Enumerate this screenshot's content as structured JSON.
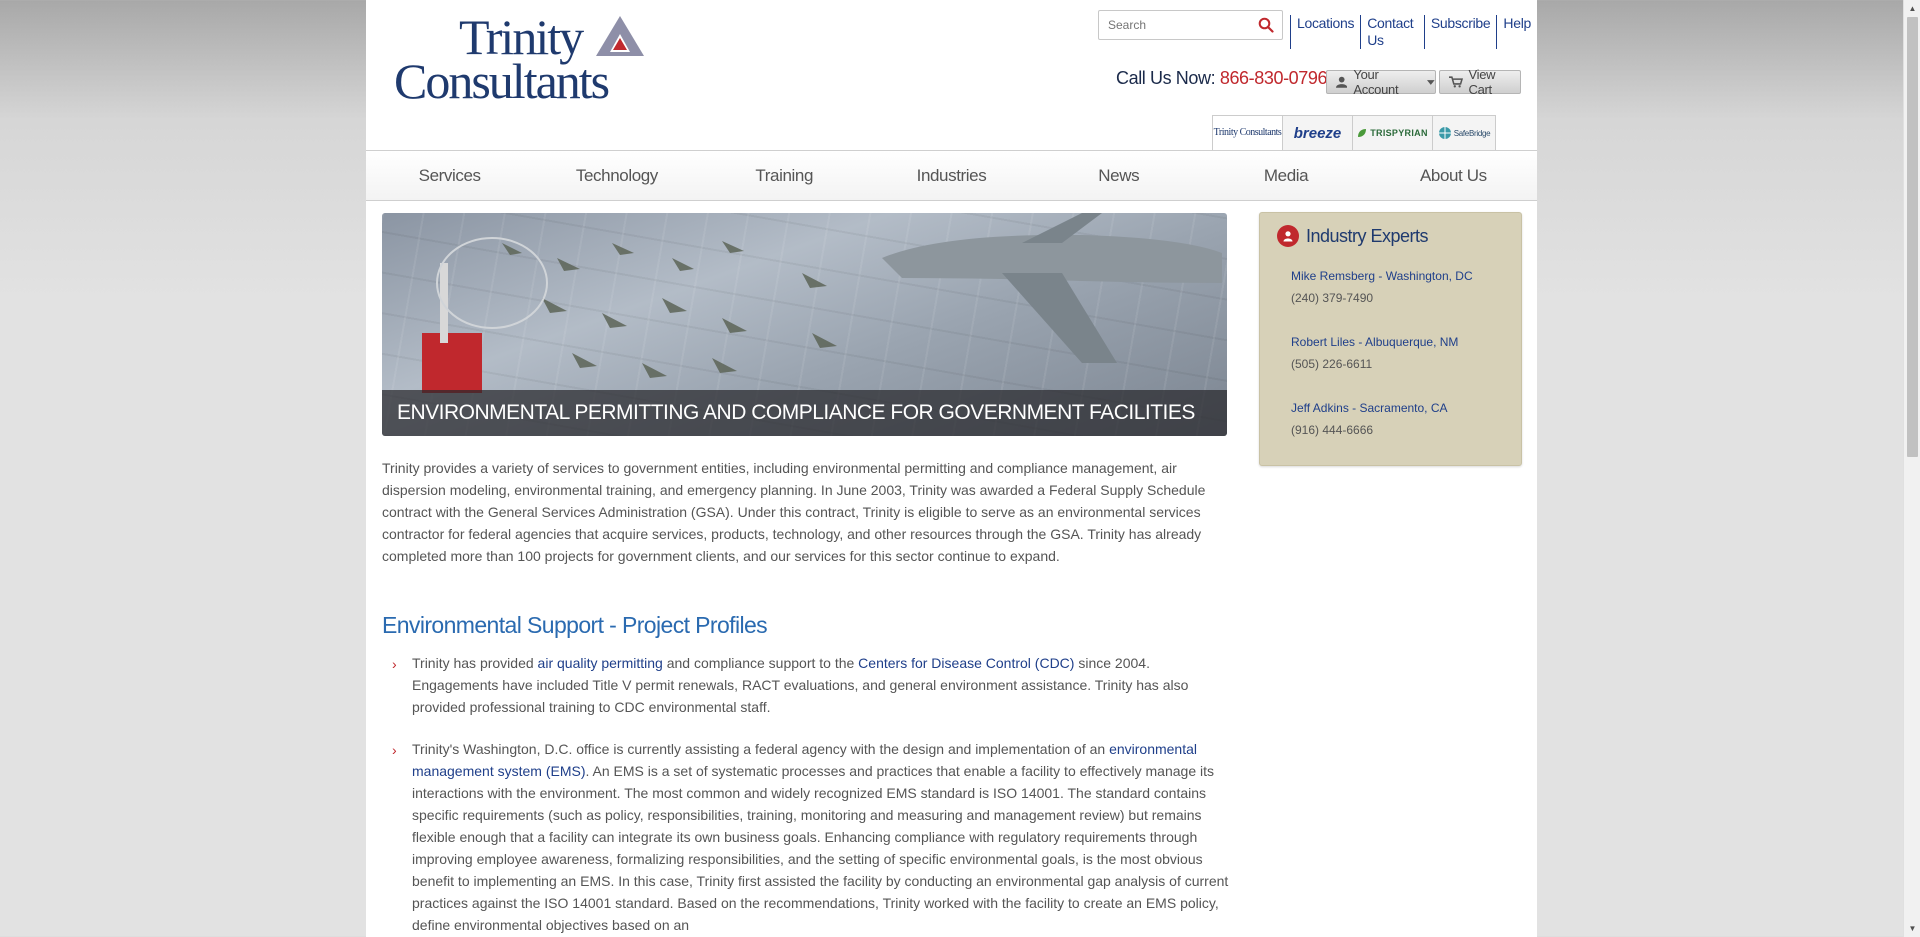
{
  "header": {
    "logo_text_line1": "Trinity",
    "logo_text_line2": "Consultants",
    "search_placeholder": "Search",
    "toplinks": [
      "Locations",
      "Contact Us",
      "Subscribe",
      "Help"
    ],
    "call_label": "Call Us Now:",
    "call_number": "866-830-0796",
    "account_label": "Your Account",
    "cart_label": "View Cart",
    "brands": [
      "Trinity Consultants",
      "breeze",
      "TRISPYRIAN",
      "SafeBridge"
    ]
  },
  "nav": {
    "items": [
      "Services",
      "Technology",
      "Training",
      "Industries",
      "News",
      "Media",
      "About Us"
    ]
  },
  "hero": {
    "caption": "ENVIRONMENTAL PERMITTING AND COMPLIANCE FOR GOVERNMENT FACILITIES"
  },
  "intro": {
    "text": "Trinity provides a variety of services to government entities, including environmental permitting and compliance management, air dispersion modeling, environmental training, and emergency planning. In June 2003, Trinity was awarded a Federal Supply Schedule contract with the General Services Administration (GSA). Under this contract, Trinity is eligible to serve as an environmental services contractor for federal agencies that acquire services, products, technology, and other resources through the GSA. Trinity has already completed more than 100 projects for government clients, and our services for this sector continue to expand."
  },
  "section": {
    "title": "Environmental Support - Project Profiles",
    "p1_a": "Trinity has provided ",
    "p1_link1": "air quality permitting",
    "p1_b": " and compliance support to the ",
    "p1_link2": "Centers for Disease Control (CDC)",
    "p1_c": " since 2004. Engagements have included Title V permit renewals, RACT evaluations, and general environment assistance. Trinity has also provided professional training to CDC environmental staff.",
    "p2_a": "Trinity's Washington, D.C. office is currently assisting a federal agency with the design and implementation of an ",
    "p2_link": "environmental management system (EMS)",
    "p2_b": ". An EMS is a set of systematic processes and practices that enable a facility to effectively manage its interactions with the environment. The most common and widely recognized EMS standard is ISO 14001. The standard contains specific requirements (such as policy, responsibilities, training, monitoring and measuring and management review) but remains flexible enough that a facility can integrate its own business goals. Enhancing compliance with regulatory requirements through improving employee awareness, formalizing responsibilities, and the setting of specific environmental goals, is the most obvious benefit to implementing an EMS. In this case, Trinity first assisted the facility by conducting an environmental gap analysis of current practices against the ISO 14001 standard. Based on the recommendations, Trinity worked with the facility to create an EMS policy, define environmental objectives based on an"
  },
  "sidebar": {
    "title": "Industry Experts",
    "experts": [
      {
        "name": "Mike Remsberg - Washington, DC",
        "phone": "(240) 379-7490"
      },
      {
        "name": "Robert Liles - Albuquerque, NM",
        "phone": "(505) 226-6611"
      },
      {
        "name": "Jeff Adkins - Sacramento, CA",
        "phone": "(916) 444-6666"
      }
    ]
  },
  "colors": {
    "brand_navy": "#1f3f8a",
    "accent_red": "#c0282d",
    "section_blue": "#2a6ab0",
    "sidebar_bg": "#d7d1b8"
  }
}
